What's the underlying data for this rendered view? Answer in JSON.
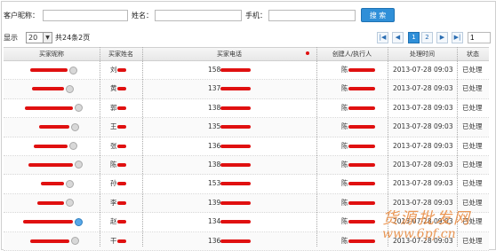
{
  "search": {
    "customer_nick_label": "客户昵称：",
    "customer_nick_value": "",
    "name_label": "姓名：",
    "name_value": "",
    "phone_label": "手机：",
    "phone_value": "",
    "search_button": "搜 索"
  },
  "pager": {
    "show_label": "显示",
    "page_size": "20",
    "summary": "共24条2页",
    "first_icon": "first-page-icon",
    "prev_icon": "prev-page-icon",
    "pages": [
      "1",
      "2"
    ],
    "current_page": "1",
    "next_icon": "next-page-icon",
    "last_icon": "last-page-icon",
    "goto_value": "1"
  },
  "table": {
    "columns": [
      "买家昵称",
      "买家姓名",
      "买家电话",
      "创建人/执行人",
      "处理时间",
      "状态"
    ],
    "rows": [
      {
        "nick": "",
        "name": "刘",
        "phone": "158",
        "creator": "陈",
        "time": "2013-07-28 09:03",
        "status": "已处理"
      },
      {
        "nick": "",
        "name": "黄",
        "phone": "137",
        "creator": "陈",
        "time": "2013-07-28 09:03",
        "status": "已处理"
      },
      {
        "nick": "",
        "name": "郭",
        "phone": "138",
        "creator": "陈",
        "time": "2013-07-28 09:03",
        "status": "已处理"
      },
      {
        "nick": "",
        "name": "王",
        "phone": "135",
        "creator": "陈",
        "time": "2013-07-28 09:03",
        "status": "已处理"
      },
      {
        "nick": "",
        "name": "张",
        "phone": "136",
        "creator": "陈",
        "time": "2013-07-28 09:03",
        "status": "已处理"
      },
      {
        "nick": "",
        "name": "陈",
        "phone": "138",
        "creator": "陈",
        "time": "2013-07-28 09:03",
        "status": "已处理"
      },
      {
        "nick": "",
        "name": "孙",
        "phone": "153",
        "creator": "陈",
        "time": "2013-07-28 09:03",
        "status": "已处理"
      },
      {
        "nick": "",
        "name": "李",
        "phone": "139",
        "creator": "陈",
        "time": "2013-07-28 09:03",
        "status": "已处理"
      },
      {
        "nick": "",
        "name": "赵",
        "phone": "134",
        "creator": "陈",
        "time": "2013-07-28 09:03",
        "status": "已处理"
      },
      {
        "nick": "",
        "name": "干",
        "phone": "136",
        "creator": "陈",
        "time": "2013-07-28 09:03",
        "status": "已处理"
      }
    ]
  },
  "watermark": {
    "title": "货源批发网",
    "url": "www.6pf.cn"
  },
  "colors": {
    "accent": "#2f8fd8",
    "redaction": "#e01010",
    "watermark": "#e8873a"
  }
}
